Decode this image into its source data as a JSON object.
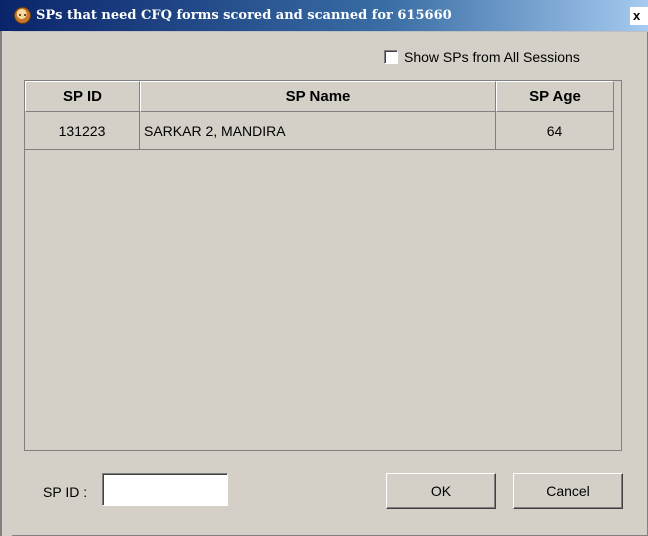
{
  "window": {
    "title": "SPs that need CFQ forms scored and scanned for 615660",
    "close_glyph": "x",
    "icon": "app-face-icon"
  },
  "options": {
    "show_all_sessions_label": "Show SPs from All Sessions",
    "show_all_sessions_checked": false
  },
  "table": {
    "headers": [
      "SP ID",
      "SP Name",
      "SP Age"
    ],
    "rows": [
      [
        "131223",
        "SARKAR 2, MANDIRA",
        "64"
      ]
    ]
  },
  "footer": {
    "sp_id_label": "SP ID :",
    "sp_id_value": "",
    "ok_label": "OK",
    "cancel_label": "Cancel"
  }
}
